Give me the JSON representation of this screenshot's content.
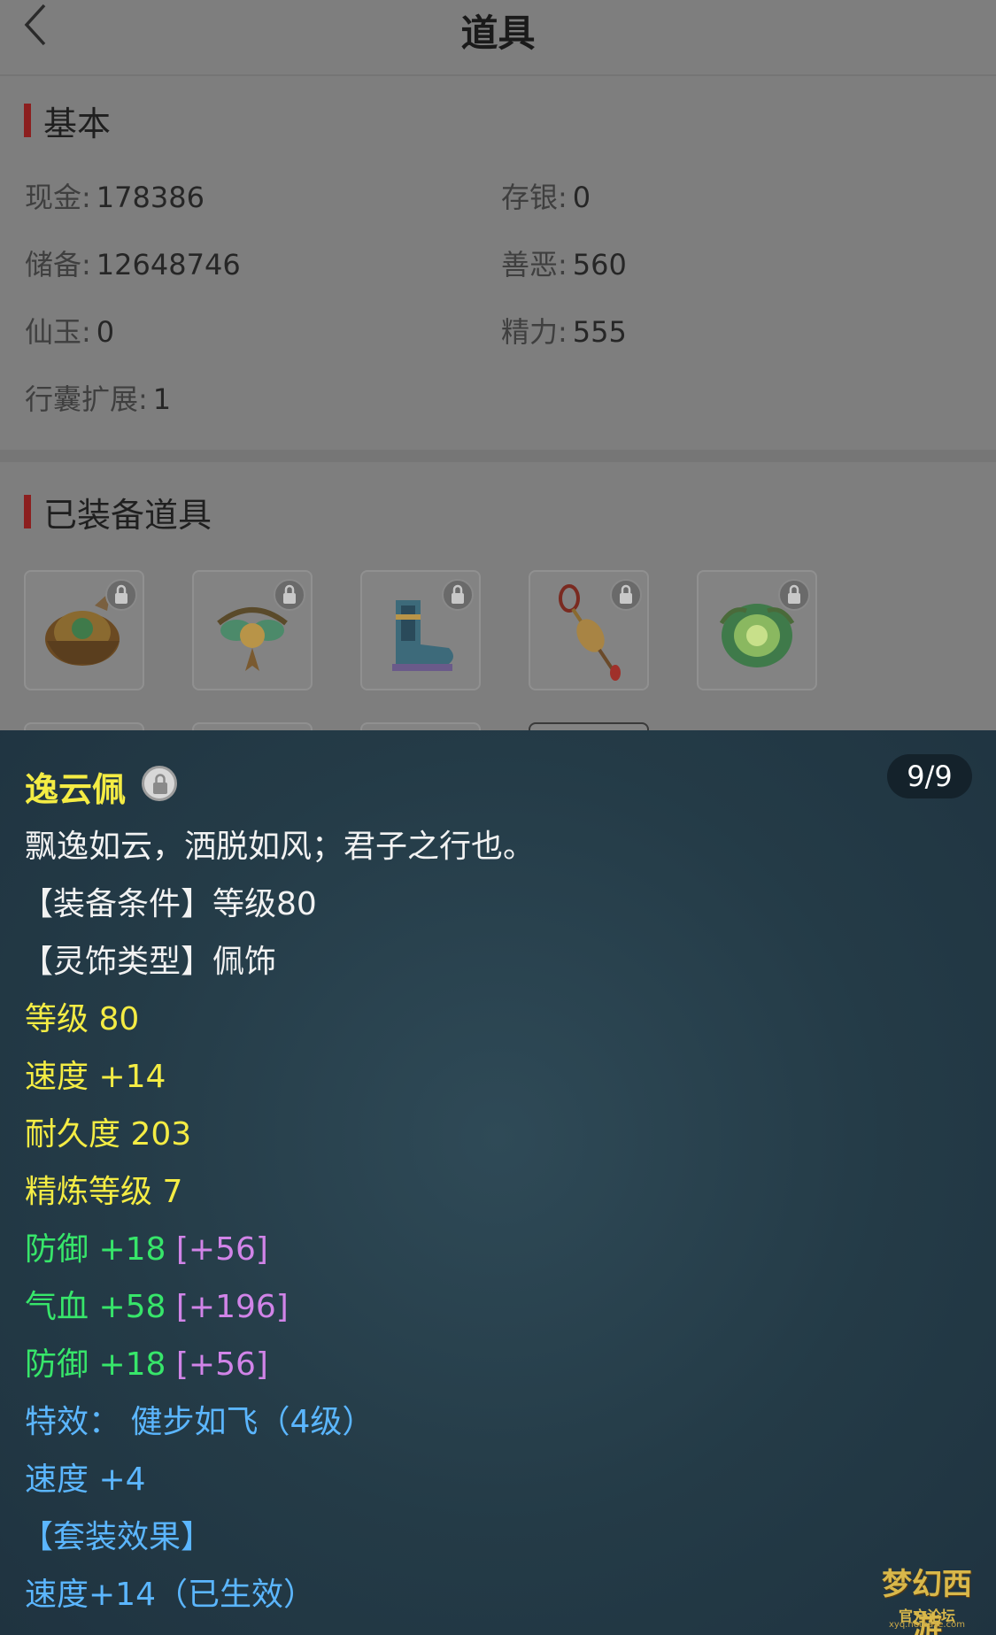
{
  "nav": {
    "title": "道具"
  },
  "basic": {
    "title": "基本",
    "fields": [
      {
        "label": "现金:",
        "value": "178386"
      },
      {
        "label": "存银:",
        "value": "0"
      },
      {
        "label": "储备:",
        "value": "12648746"
      },
      {
        "label": "善恶:",
        "value": "560"
      },
      {
        "label": "仙玉:",
        "value": "0"
      },
      {
        "label": "精力:",
        "value": "555"
      },
      {
        "label": "行囊扩展:",
        "value": "1"
      }
    ]
  },
  "equipped": {
    "title": "已装备道具",
    "items": [
      {
        "icon": "helmet-icon",
        "locked": true
      },
      {
        "icon": "necklace-icon",
        "locked": true
      },
      {
        "icon": "boots-icon",
        "locked": true
      },
      {
        "icon": "pendant-icon",
        "locked": true
      },
      {
        "icon": "orb-icon",
        "locked": true
      }
    ]
  },
  "tooltip": {
    "name": "逸云佩",
    "counter": "9/9",
    "description": "飘逸如云，洒脱如风；君子之行也。",
    "requirement": "【装备条件】等级80",
    "type_line": "【灵饰类型】佩饰",
    "level": "等级 80",
    "speed": "速度 +14",
    "durability": "耐久度 203",
    "refine": "精炼等级 7",
    "attrs": [
      {
        "base": "防御 +18",
        "bonus": "[+56]"
      },
      {
        "base": "气血 +58",
        "bonus": "[+196]"
      },
      {
        "base": "防御 +18",
        "bonus": "[+56]"
      }
    ],
    "special": "特效：  健步如飞（4级）",
    "speed_bonus": "速度 +4",
    "set_header": "【套装效果】",
    "set_effect": "速度+14（已生效）"
  },
  "watermark": {
    "logo": "梦幻西游",
    "sub": "官方论坛",
    "url": "xyq.netease.com"
  },
  "colors": {
    "name": "#f4ec44",
    "green": "#37e66a",
    "purple": "#d184e8",
    "blue": "#5bb6ff"
  }
}
